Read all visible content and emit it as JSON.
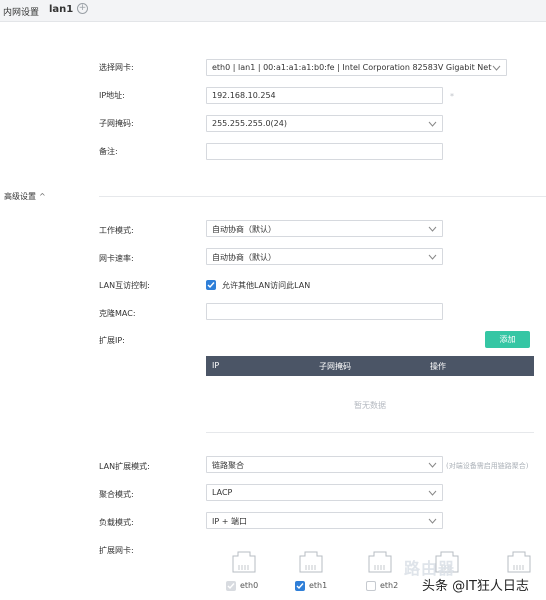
{
  "header": {
    "title": "内网设置",
    "interface": "lan1"
  },
  "basic": {
    "nic_label": "选择网卡:",
    "nic_value": "eth0 | lan1 | 00:a1:a1:a1:b0:fe | Intel Corporation 82583V Gigabit Netw",
    "ip_label": "IP地址:",
    "ip_value": "192.168.10.254",
    "ip_required": "*",
    "mask_label": "子网掩码:",
    "mask_value": "255.255.255.0(24)",
    "note_label": "备注:",
    "note_value": ""
  },
  "advanced": {
    "toggle_label": "高级设置",
    "work_mode_label": "工作模式:",
    "work_mode_value": "自动协商（默认）",
    "speed_label": "网卡速率:",
    "speed_value": "自动协商（默认）",
    "lan_access_label": "LAN互访控制:",
    "lan_access_checkbox_label": "允许其他LAN访问此LAN",
    "lan_access_checked": true,
    "clone_mac_label": "克隆MAC:",
    "clone_mac_value": "",
    "ext_ip_label": "扩展IP:",
    "add_button": "添加",
    "table": {
      "headers": [
        "IP",
        "子网掩码",
        "操作"
      ],
      "empty_text": "暂无数据"
    },
    "lan_ext_mode_label": "LAN扩展模式:",
    "lan_ext_mode_value": "链路聚合",
    "lan_ext_mode_hint": "(对端设备需启用链路聚合)",
    "agg_mode_label": "聚合模式:",
    "agg_mode_value": "LACP",
    "load_mode_label": "负载模式:",
    "load_mode_value": "IP + 端口",
    "ext_nic_label": "扩展网卡:",
    "ports": [
      {
        "name": "eth0",
        "state": "disabled-checked"
      },
      {
        "name": "eth1",
        "state": "checked"
      },
      {
        "name": "eth2",
        "state": "unchecked"
      }
    ]
  },
  "watermark": {
    "logo": "路由器",
    "text": "头条 @IT狂人日志"
  },
  "colors": {
    "primary": "#2f7fd8",
    "add_button": "#35c6a4",
    "table_header": "#4b5566"
  }
}
